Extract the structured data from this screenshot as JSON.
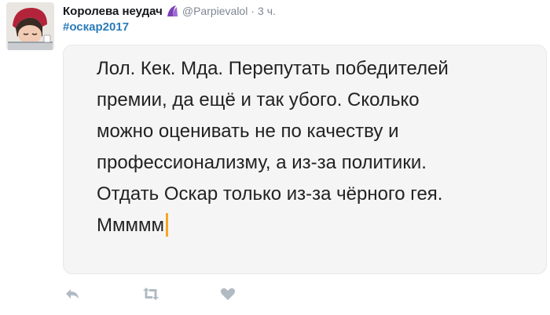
{
  "tweet": {
    "display_name": "Королева неудач",
    "handle": "@Parpievalol",
    "separator": "·",
    "time": "3 ч.",
    "hashtag": "#оскар2017",
    "note_lines": [
      "Лол. Кек. Мда. Перепутать победителей",
      "премии, да ещё и так убого. Сколько",
      "можно оценивать не по качеству и",
      "профессионализму, а из-за политики.",
      "Отдать Оскар только из-за чёрного гея.",
      "Ммммм"
    ]
  },
  "icons": {
    "avatar": "avatar-image",
    "badge": "purple-crescent-icon",
    "reply": "reply-icon",
    "retweet": "retweet-icon",
    "like": "heart-icon"
  },
  "colors": {
    "hashtag": "#2b7bb9",
    "muted": "#7d8791",
    "cursor": "#f5a623",
    "note_background": "#f5f5f5",
    "badge": "#7b3fb5"
  }
}
